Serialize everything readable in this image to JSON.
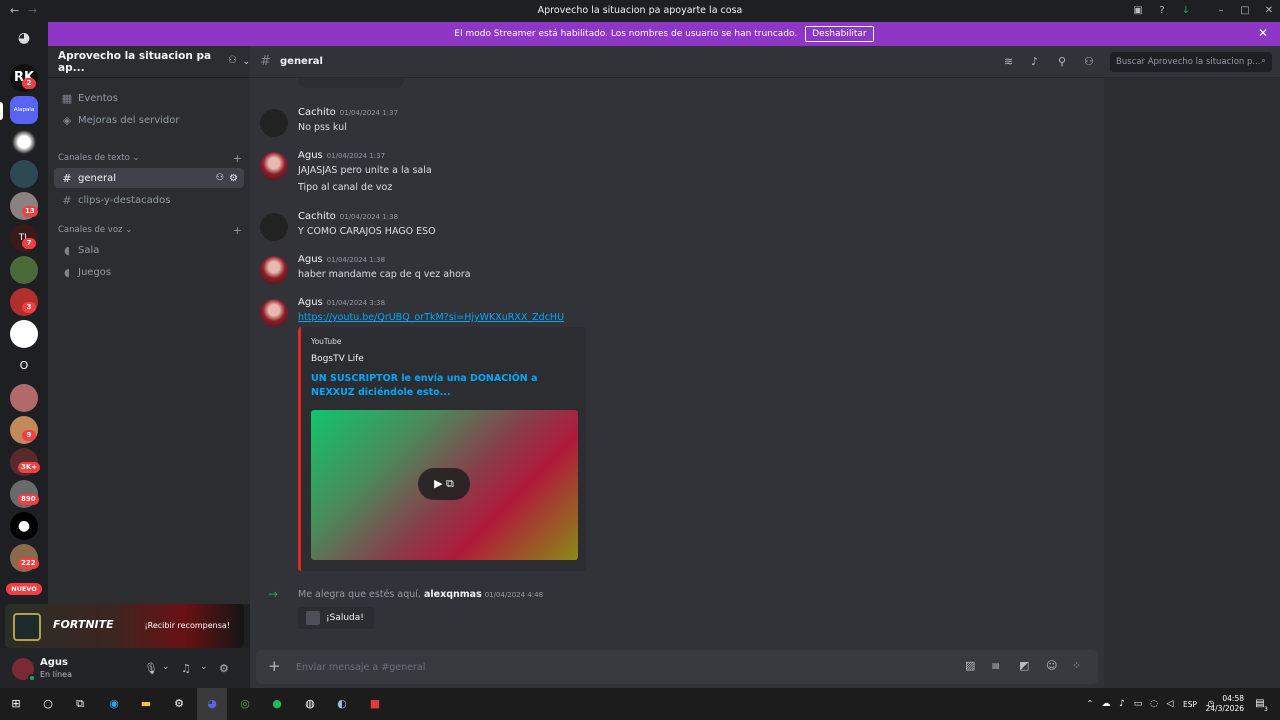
{
  "window": {
    "title": "Aprovecho la situacion pa apoyarte la cosa"
  },
  "banner": {
    "text": "El modo Streamer está habilitado. Los nombres de usuario se han truncado.",
    "button": "Deshabilitar"
  },
  "servers": [
    {
      "name": "server-rk",
      "badge": "2"
    },
    {
      "name": "server-alapala",
      "label": "Alapala"
    },
    {
      "name": "server-3",
      "badge": ""
    },
    {
      "name": "server-4",
      "badge": ""
    },
    {
      "name": "server-5",
      "badge": "13"
    },
    {
      "name": "server-tl",
      "badge": "7"
    },
    {
      "name": "server-7",
      "badge": ""
    },
    {
      "name": "server-dennys",
      "badge": "3"
    },
    {
      "name": "server-9",
      "badge": ""
    },
    {
      "name": "server-o",
      "label": "O"
    },
    {
      "name": "server-11",
      "badge": ""
    },
    {
      "name": "server-12",
      "badge": "9"
    },
    {
      "name": "server-13",
      "badge": "3K+"
    },
    {
      "name": "server-14",
      "badge": "890"
    },
    {
      "name": "server-apple",
      "badge": ""
    },
    {
      "name": "server-16",
      "badge": "222"
    }
  ],
  "nuevo_badge": "NUEVO",
  "sidebar": {
    "guild_name": "Aprovecho la situacion pa ap...",
    "events": "Eventos",
    "boosts": "Mejoras del servidor",
    "text_category": "Canales de texto",
    "text_channels": [
      "general",
      "clips-y-destacados"
    ],
    "voice_category": "Canales de voz",
    "voice_channels": [
      "Sala",
      "Juegos"
    ]
  },
  "promo": {
    "game": "FORTNITE",
    "cta": "¡Recibir recompensa!"
  },
  "user": {
    "name": "Agus",
    "status": "En línea"
  },
  "channel": {
    "name": "general",
    "search_placeholder": "Buscar Aprovecho la situacion p..."
  },
  "messages": [
    {
      "author": "Cachito",
      "ts": "01/04/2024 1:37",
      "lines": [
        "No pss kul"
      ]
    },
    {
      "author": "Agus",
      "ts": "01/04/2024 1:37",
      "lines": [
        "JAJASJAS pero unite a la sala",
        "Tipo al canal de voz"
      ]
    },
    {
      "author": "Cachito",
      "ts": "01/04/2024 1:38",
      "lines": [
        "Y COMO CARAJOS HAGO ESO"
      ]
    },
    {
      "author": "Agus",
      "ts": "01/04/2024 1:38",
      "lines": [
        "haber mandame cap de q vez ahora"
      ]
    },
    {
      "author": "Agus",
      "ts": "01/04/2024 3:38",
      "lines": [
        "https://youtu.be/QrUBQ_orTkM?si=HjyWKXuRXX_ZdcHU"
      ]
    }
  ],
  "embed": {
    "provider": "YouTube",
    "author": "BogsTV Life",
    "title": "UN SUSCRIPTOR le envía una DONACIÓN a NEXXUZ diciéndole esto..."
  },
  "join": {
    "text": "Me alegra que estés aquí,",
    "user": "alexqnmas",
    "ts": "01/04/2024 4:48",
    "wave": "¡Saluda!"
  },
  "composer": {
    "placeholder": "Enviar mensaje a #general"
  },
  "taskbar": {
    "lang": "ESP",
    "time": "04:58",
    "date": "24/3/2026",
    "notif": "3"
  }
}
